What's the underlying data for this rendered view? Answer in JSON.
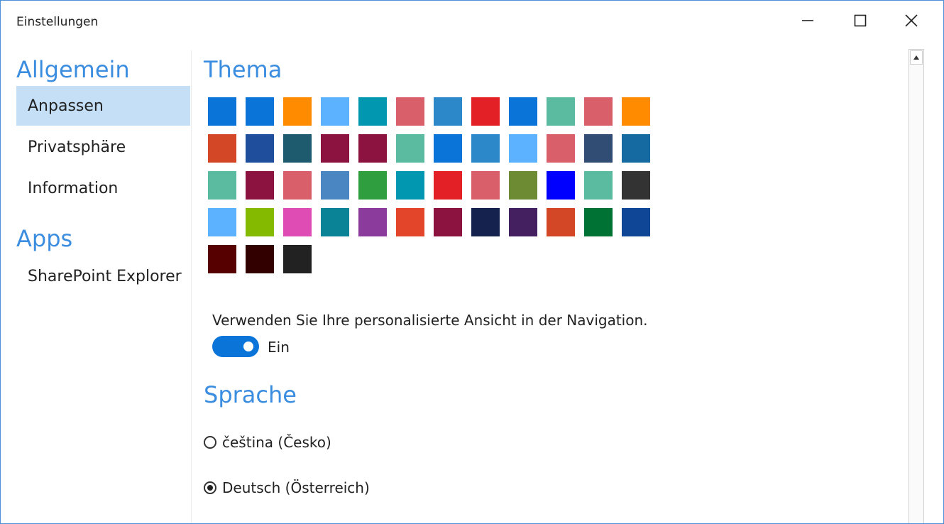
{
  "window": {
    "title": "Einstellungen"
  },
  "sidebar": {
    "sections": [
      {
        "title": "Allgemein",
        "items": [
          {
            "label": "Anpassen",
            "selected": true
          },
          {
            "label": "Privatsphäre",
            "selected": false
          },
          {
            "label": "Information",
            "selected": false
          }
        ]
      },
      {
        "title": "Apps",
        "items": [
          {
            "label": "SharePoint Explorer",
            "selected": false
          }
        ]
      }
    ]
  },
  "theme": {
    "title": "Thema",
    "swatch_rows": [
      [
        "#0a74d9",
        "#0a74d9",
        "#ff8c00",
        "#5db2ff",
        "#0197b0",
        "#d95f6a",
        "#2c88c9",
        "#e32026",
        "#0a74d9",
        "#5bbba0",
        "#d95f6a",
        "#ff8c00"
      ],
      [
        "#d34726",
        "#1f4e9c",
        "#1f5b6e",
        "#8c1340",
        "#8c1340",
        "#5bbba0",
        "#0a74d9",
        "#2c88c9",
        "#5db2ff",
        "#d95f6a",
        "#324d73",
        "#156aa1"
      ],
      [
        "#5bbba0",
        "#8c1340",
        "#d95f6a",
        "#4a87c2",
        "#2e9e3e",
        "#0197b0",
        "#e32026",
        "#d95f6a",
        "#6d8b33",
        "#0000ff",
        "#5bbba0",
        "#333333"
      ],
      [
        "#5db2ff",
        "#84bb00",
        "#df4db4",
        "#0b8396",
        "#8b3b9b",
        "#e3452a",
        "#8c1340",
        "#15224e",
        "#442060",
        "#d34726",
        "#007233",
        "#0f4695"
      ],
      [
        "#560000",
        "#330000",
        "#222222"
      ]
    ]
  },
  "navigation_toggle": {
    "label": "Verwenden Sie Ihre personalisierte Ansicht in der Navigation.",
    "state_label": "Ein",
    "on": true
  },
  "language": {
    "title": "Sprache",
    "options": [
      {
        "label": "čeština (Česko)",
        "checked": false
      },
      {
        "label": "Deutsch (Österreich)",
        "checked": true
      }
    ]
  },
  "icons": {
    "minimize": "minimize-icon",
    "maximize": "maximize-icon",
    "close": "close-icon",
    "scroll_up": "scroll-up-arrow-icon"
  }
}
